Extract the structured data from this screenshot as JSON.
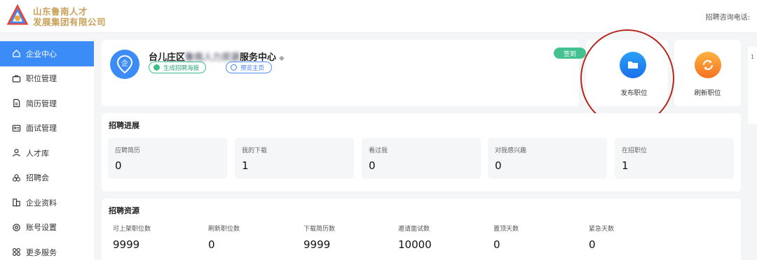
{
  "header": {
    "brand_line1": "山东鲁南人才",
    "brand_line2": "发展集团有限公司",
    "hotline_label": "招聘咨询电话:"
  },
  "sidebar": {
    "items": [
      {
        "label": "企业中心",
        "icon": "home-icon",
        "active": true
      },
      {
        "label": "职位管理",
        "icon": "briefcase-icon"
      },
      {
        "label": "简历管理",
        "icon": "document-icon"
      },
      {
        "label": "面试管理",
        "icon": "id-card-icon"
      },
      {
        "label": "人才库",
        "icon": "user-icon"
      },
      {
        "label": "招聘会",
        "icon": "circles-icon"
      },
      {
        "label": "企业资料",
        "icon": "building-icon"
      },
      {
        "label": "账号设置",
        "icon": "gear-icon"
      },
      {
        "label": "更多服务",
        "icon": "services-icon"
      }
    ]
  },
  "company": {
    "avatar_glyph": "企",
    "name_visible": "台儿庄区",
    "name_obscured": "鲁南人力资源",
    "name_suffix": "服务中心",
    "poster_button": "生成招聘海报",
    "preview_button": "预览主页",
    "signin_button": "签到"
  },
  "actions": {
    "publish_label": "发布职位",
    "refresh_label": "刷新职位"
  },
  "right_stub_text": "1",
  "progress": {
    "title": "招聘进展",
    "stats": [
      {
        "label": "应聘简历",
        "value": "0"
      },
      {
        "label": "我的下载",
        "value": "1"
      },
      {
        "label": "看过我",
        "value": "0"
      },
      {
        "label": "对我感兴趣",
        "value": "0"
      },
      {
        "label": "在招职位",
        "value": "1"
      }
    ]
  },
  "resources": {
    "title": "招聘资源",
    "items": [
      {
        "label": "可上架职位数",
        "value": "9999"
      },
      {
        "label": "刷新职位数",
        "value": "0"
      },
      {
        "label": "下载简历数",
        "value": "9999"
      },
      {
        "label": "邀请面试数",
        "value": "10000"
      },
      {
        "label": "置顶天数",
        "value": "0"
      },
      {
        "label": "紧急天数",
        "value": "0"
      }
    ]
  },
  "colors": {
    "primary": "#3b8cf7",
    "success": "#44c191",
    "brand_gold": "#c9a15a",
    "highlight_ring": "#b5261f"
  }
}
